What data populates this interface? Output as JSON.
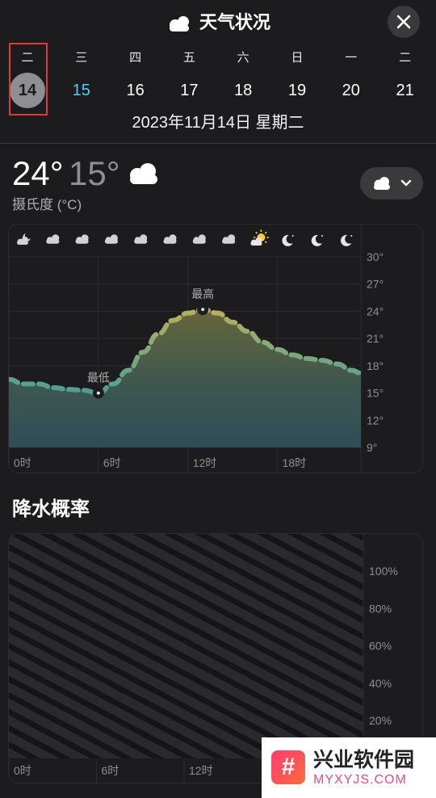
{
  "header": {
    "title": "天气状况",
    "icon": "cloud-icon"
  },
  "week": {
    "days": [
      {
        "weekday": "二",
        "date": "14",
        "state": "selected"
      },
      {
        "weekday": "三",
        "date": "15",
        "state": "today"
      },
      {
        "weekday": "四",
        "date": "16",
        "state": "normal"
      },
      {
        "weekday": "五",
        "date": "17",
        "state": "normal"
      },
      {
        "weekday": "六",
        "date": "18",
        "state": "normal"
      },
      {
        "weekday": "日",
        "date": "19",
        "state": "normal"
      },
      {
        "weekday": "一",
        "date": "20",
        "state": "normal"
      },
      {
        "weekday": "二",
        "date": "21",
        "state": "normal"
      }
    ]
  },
  "summary": {
    "date_line": "2023年11月14日 星期二",
    "high": "24°",
    "low": "15°",
    "unit": "摄氏度 (°C)",
    "condition_icon": "cloud-icon"
  },
  "hourly_icons": [
    "partly-cloudy-night-icon",
    "cloud-icon",
    "cloud-icon",
    "cloud-icon",
    "cloud-icon",
    "cloud-icon",
    "cloud-icon",
    "cloud-icon",
    "partly-sunny-icon",
    "moon-icon",
    "moon-icon",
    "moon-icon"
  ],
  "chart_data": [
    {
      "type": "area",
      "x_ticks": [
        "0时",
        "6时",
        "12时",
        "18时"
      ],
      "y_ticks": [
        "30°",
        "27°",
        "24°",
        "21°",
        "18°",
        "15°",
        "12°",
        "9°"
      ],
      "ylim": [
        9,
        30
      ],
      "x": [
        0,
        1,
        2,
        3,
        4,
        5,
        6,
        7,
        8,
        9,
        10,
        11,
        12,
        13,
        14,
        15,
        16,
        17,
        18,
        19,
        20,
        21,
        22,
        23
      ],
      "values": [
        16.5,
        16.0,
        16.0,
        15.6,
        15.4,
        15.3,
        15.0,
        16.0,
        17.5,
        19.5,
        21.5,
        23.0,
        23.8,
        24.2,
        23.8,
        22.8,
        21.8,
        20.6,
        19.8,
        19.2,
        18.8,
        18.6,
        18.2,
        17.5
      ],
      "annotations": [
        {
          "label": "最低",
          "x": 6,
          "y": 15.0
        },
        {
          "label": "最高",
          "x": 13,
          "y": 24.2
        }
      ]
    },
    {
      "type": "area",
      "title": "降水概率",
      "x_ticks": [
        "0时",
        "6时",
        "12时"
      ],
      "y_ticks": [
        "100%",
        "80%",
        "60%",
        "40%",
        "20%"
      ],
      "ylim": [
        0,
        100
      ],
      "values": []
    }
  ],
  "watermark": {
    "cn": "兴业软件园",
    "en": "MYXYJS.COM",
    "logo": "#"
  }
}
